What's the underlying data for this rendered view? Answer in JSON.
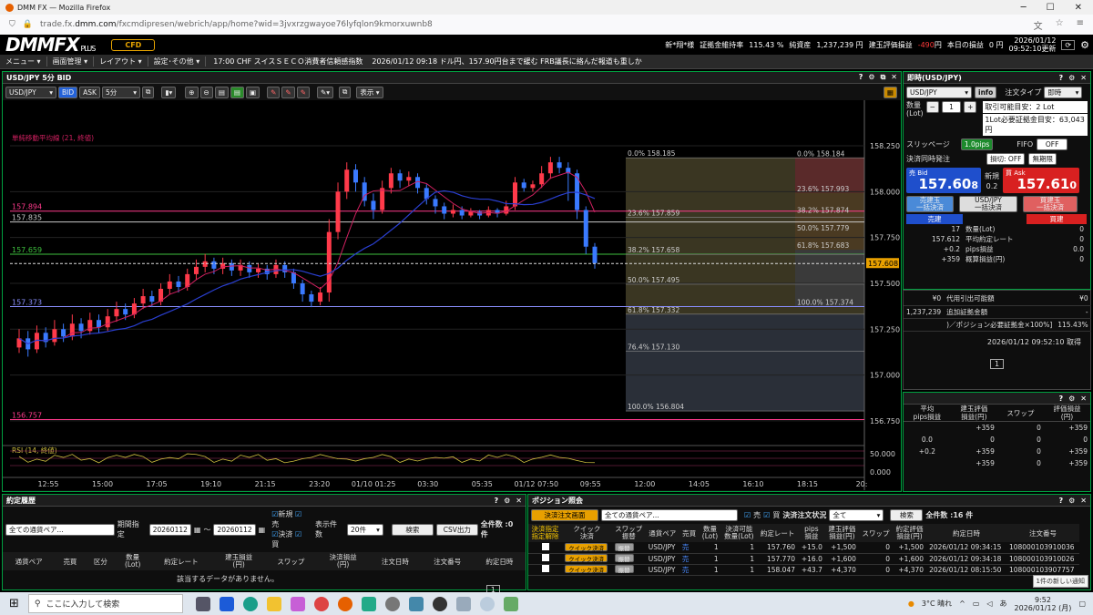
{
  "browser": {
    "window_title": "DMM FX — Mozilla Firefox",
    "url_prefix": "trade.fx.",
    "url_host": "dmm.com",
    "url_rest": "/fxcmdipresen/webrich/app/home?wid=3jvxrzgwayoe76lyfqlon9kmorxuwnb8"
  },
  "header": {
    "logo_main": "DMMFX",
    "logo_sub": "PLUS",
    "cfd_label": "CFD",
    "account_name": "新*翔*様",
    "margin_ratio_label": "証拠金維持率",
    "margin_ratio_value": "115.43 %",
    "net_assets_label": "純資産",
    "net_assets_value": "1,237,239 円",
    "unrealized_label": "建玉評価損益",
    "unrealized_value": "-490",
    "unrealized_unit": "円",
    "today_loss_label": "本日の損益",
    "today_loss_value": "0 円",
    "datetime_date": "2026/01/12",
    "datetime_time": "09:52:10更新"
  },
  "menubar": {
    "items": [
      "メニュー ▾",
      "画面管理 ▾",
      "レイアウト ▾",
      "設定･その他 ▾"
    ],
    "news1": "17:00 CHF スイスＳＥＣＯ消費者信頼感指数",
    "news2": "2026/01/12 09:18 ドル円、157.90円台まで緩む FRB議長に絡んだ報道も重しか"
  },
  "chart_panel": {
    "title": "USD/JPY 5分 BID",
    "pair": "USD/JPY",
    "bid": "BID",
    "ask": "ASK",
    "interval": "5分",
    "display_btn": "表示 ▾",
    "ma_label": "単純移動平均線 (21, 終値)",
    "rsi_label": "RSI (14, 終値)"
  },
  "chart_data": {
    "type": "candlestick",
    "ylim": [
      156.65,
      158.3
    ],
    "y_ticks": [
      "158.250",
      "158.000",
      "157.750",
      "157.500",
      "157.250",
      "157.000",
      "156.750"
    ],
    "x_ticks": [
      "12:55",
      "15:00",
      "17:05",
      "19:10",
      "21:15",
      "23:20",
      "01/10 01:25",
      "03:30",
      "05:35",
      "01/12 07:50",
      "09:55",
      "12:00",
      "14:05",
      "16:10",
      "18:15",
      "20:"
    ],
    "hlines": [
      {
        "label": "157.894",
        "value": 157.894,
        "color": "#ff3a8c"
      },
      {
        "label": "157.835",
        "value": 157.835,
        "color": "#c8c8c8"
      },
      {
        "label": "157.659",
        "value": 157.659,
        "color": "#3ec03e"
      },
      {
        "label": "157.373",
        "value": 157.373,
        "color": "#8a8fff"
      },
      {
        "label": "156.757",
        "value": 156.757,
        "color": "#ff3a8c"
      }
    ],
    "current_price": "157.608",
    "fib_left": [
      {
        "label": "0.0% 158.185",
        "value": 158.185
      },
      {
        "label": "23.6% 157.859",
        "value": 157.859
      },
      {
        "label": "38.2% 157.658",
        "value": 157.658
      },
      {
        "label": "50.0% 157.495",
        "value": 157.495
      },
      {
        "label": "61.8% 157.332",
        "value": 157.332
      },
      {
        "label": "76.4% 157.130",
        "value": 157.13
      },
      {
        "label": "100.0% 156.804",
        "value": 156.804
      }
    ],
    "fib_right": [
      {
        "label": "0.0% 158.184",
        "value": 158.184
      },
      {
        "label": "23.6% 157.993",
        "value": 157.993
      },
      {
        "label": "38.2% 157.874",
        "value": 157.874
      },
      {
        "label": "50.0% 157.779",
        "value": 157.779
      },
      {
        "label": "61.8% 157.683",
        "value": 157.683
      },
      {
        "label": "100.0% 157.374",
        "value": 157.374
      }
    ],
    "rsi_ticks": [
      "50.000",
      "0.000"
    ],
    "candles": [
      {
        "o": 157.15,
        "c": 157.2,
        "h": 157.25,
        "l": 157.12
      },
      {
        "o": 157.2,
        "c": 157.14,
        "h": 157.24,
        "l": 157.1
      },
      {
        "o": 157.14,
        "c": 157.23,
        "h": 157.27,
        "l": 157.12
      },
      {
        "o": 157.23,
        "c": 157.18,
        "h": 157.26,
        "l": 157.15
      },
      {
        "o": 157.18,
        "c": 157.25,
        "h": 157.3,
        "l": 157.16
      },
      {
        "o": 157.25,
        "c": 157.21,
        "h": 157.28,
        "l": 157.18
      },
      {
        "o": 157.21,
        "c": 157.28,
        "h": 157.33,
        "l": 157.19
      },
      {
        "o": 157.28,
        "c": 157.24,
        "h": 157.31,
        "l": 157.2
      },
      {
        "o": 157.24,
        "c": 157.3,
        "h": 157.34,
        "l": 157.22
      },
      {
        "o": 157.3,
        "c": 157.26,
        "h": 157.33,
        "l": 157.23
      },
      {
        "o": 157.26,
        "c": 157.32,
        "h": 157.36,
        "l": 157.24
      },
      {
        "o": 157.32,
        "c": 157.36,
        "h": 157.4,
        "l": 157.29
      },
      {
        "o": 157.36,
        "c": 157.33,
        "h": 157.39,
        "l": 157.3
      },
      {
        "o": 157.33,
        "c": 157.39,
        "h": 157.42,
        "l": 157.31
      },
      {
        "o": 157.39,
        "c": 157.43,
        "h": 157.47,
        "l": 157.36
      },
      {
        "o": 157.43,
        "c": 157.4,
        "h": 157.46,
        "l": 157.37
      },
      {
        "o": 157.4,
        "c": 157.47,
        "h": 157.5,
        "l": 157.38
      },
      {
        "o": 157.47,
        "c": 157.51,
        "h": 157.55,
        "l": 157.44
      },
      {
        "o": 157.51,
        "c": 157.48,
        "h": 157.54,
        "l": 157.45
      },
      {
        "o": 157.48,
        "c": 157.55,
        "h": 157.58,
        "l": 157.46
      },
      {
        "o": 157.55,
        "c": 157.59,
        "h": 157.63,
        "l": 157.52
      },
      {
        "o": 157.59,
        "c": 157.62,
        "h": 157.66,
        "l": 157.56
      },
      {
        "o": 157.62,
        "c": 157.58,
        "h": 157.64,
        "l": 157.55
      },
      {
        "o": 157.58,
        "c": 157.61,
        "h": 157.64,
        "l": 157.55
      },
      {
        "o": 157.61,
        "c": 157.57,
        "h": 157.63,
        "l": 157.54
      },
      {
        "o": 157.57,
        "c": 157.6,
        "h": 157.63,
        "l": 157.54
      },
      {
        "o": 157.6,
        "c": 157.56,
        "h": 157.62,
        "l": 157.53
      },
      {
        "o": 157.56,
        "c": 157.58,
        "h": 157.61,
        "l": 157.53
      },
      {
        "o": 157.58,
        "c": 157.55,
        "h": 157.6,
        "l": 157.52
      },
      {
        "o": 157.55,
        "c": 157.6,
        "h": 157.63,
        "l": 157.53
      },
      {
        "o": 157.6,
        "c": 157.56,
        "h": 157.62,
        "l": 157.53
      },
      {
        "o": 157.56,
        "c": 157.5,
        "h": 157.58,
        "l": 157.47
      },
      {
        "o": 157.5,
        "c": 157.44,
        "h": 157.52,
        "l": 157.4
      },
      {
        "o": 157.44,
        "c": 157.4,
        "h": 157.46,
        "l": 157.37
      },
      {
        "o": 157.4,
        "c": 157.45,
        "h": 157.48,
        "l": 157.38
      },
      {
        "o": 157.45,
        "c": 157.78,
        "h": 157.85,
        "l": 157.4
      },
      {
        "o": 157.78,
        "c": 158.0,
        "h": 158.05,
        "l": 157.74
      },
      {
        "o": 158.0,
        "c": 158.12,
        "h": 158.16,
        "l": 157.96
      },
      {
        "o": 158.12,
        "c": 158.05,
        "h": 158.15,
        "l": 158.0
      },
      {
        "o": 158.05,
        "c": 157.95,
        "h": 158.08,
        "l": 157.92
      },
      {
        "o": 157.95,
        "c": 157.9,
        "h": 157.99,
        "l": 157.85
      },
      {
        "o": 157.9,
        "c": 158.02,
        "h": 158.06,
        "l": 157.88
      },
      {
        "o": 158.02,
        "c": 158.1,
        "h": 158.13,
        "l": 157.99
      },
      {
        "o": 158.1,
        "c": 158.06,
        "h": 158.12,
        "l": 158.02
      },
      {
        "o": 158.06,
        "c": 158.08,
        "h": 158.11,
        "l": 158.03
      },
      {
        "o": 158.08,
        "c": 158.02,
        "h": 158.1,
        "l": 157.99
      },
      {
        "o": 158.02,
        "c": 157.96,
        "h": 158.04,
        "l": 157.93
      },
      {
        "o": 157.96,
        "c": 157.92,
        "h": 157.98,
        "l": 157.88
      },
      {
        "o": 157.92,
        "c": 157.88,
        "h": 157.94,
        "l": 157.85
      },
      {
        "o": 157.88,
        "c": 157.9,
        "h": 157.93,
        "l": 157.86
      },
      {
        "o": 157.9,
        "c": 157.87,
        "h": 157.92,
        "l": 157.85
      },
      {
        "o": 157.87,
        "c": 157.89,
        "h": 157.91,
        "l": 157.86
      },
      {
        "o": 157.89,
        "c": 157.87,
        "h": 157.9,
        "l": 157.85
      },
      {
        "o": 157.87,
        "c": 157.9,
        "h": 157.92,
        "l": 157.86
      },
      {
        "o": 157.9,
        "c": 157.88,
        "h": 157.91,
        "l": 157.86
      },
      {
        "o": 157.88,
        "c": 157.92,
        "h": 157.95,
        "l": 157.87
      },
      {
        "o": 157.92,
        "c": 158.05,
        "h": 158.08,
        "l": 157.9
      },
      {
        "o": 158.05,
        "c": 158.02,
        "h": 158.07,
        "l": 158.0
      },
      {
        "o": 158.02,
        "c": 158.04,
        "h": 158.06,
        "l": 158.0
      },
      {
        "o": 158.04,
        "c": 158.1,
        "h": 158.14,
        "l": 158.02
      },
      {
        "o": 158.1,
        "c": 158.16,
        "h": 158.19,
        "l": 158.07
      },
      {
        "o": 158.16,
        "c": 158.13,
        "h": 158.19,
        "l": 158.1
      },
      {
        "o": 158.13,
        "c": 158.1,
        "h": 158.16,
        "l": 157.95
      },
      {
        "o": 158.1,
        "c": 157.9,
        "h": 158.12,
        "l": 157.85
      },
      {
        "o": 157.9,
        "c": 157.7,
        "h": 157.92,
        "l": 157.66
      },
      {
        "o": 157.7,
        "c": 157.61,
        "h": 157.72,
        "l": 157.58
      }
    ]
  },
  "order_panel": {
    "title": "即時(USD/JPY)",
    "pair": "USD/JPY",
    "info": "info",
    "order_type_label": "注文タイプ",
    "order_type": "即時",
    "qty_label": "数量\n(Lot)",
    "qty_value": "1",
    "tradable_label": "取引可能目安：2 Lot",
    "margin_per_lot": "1Lot必要証拠金目安：63,043円",
    "slippage_label": "スリッページ",
    "slippage_value": "1.0pips",
    "fifo_label": "FIFO",
    "fifo_value": "OFF",
    "settle_label": "決済同時発注",
    "loss_cut": "損切: OFF",
    "unlimited": "無期限",
    "bid_label": "売 Bid",
    "bid_main": "157.60",
    "bid_pip": "8",
    "new_label": "新規",
    "spread": "0.2",
    "ask_label": "買 Ask",
    "ask_main": "157.61",
    "ask_pip": "0",
    "sell_bulk": "売建玉\n一括決済",
    "pair_bulk": "USD/JPY\n一括決済",
    "buy_bulk": "買建玉\n一括決済",
    "sell_head": "売建",
    "buy_head": "買建",
    "rows": [
      {
        "left": "17",
        "label": "数量(Lot)",
        "right": "0"
      },
      {
        "left": "157.612",
        "label": "平均約定レート",
        "right": "0"
      },
      {
        "left": "+0.2",
        "label": "pips損益",
        "right": "0.0"
      },
      {
        "left": "+359",
        "label": "概算損益(円)",
        "right": "0"
      }
    ]
  },
  "account_panel": {
    "rows": [
      {
        "left": "¥0",
        "label": "代用引出可能額",
        "right": "¥0"
      },
      {
        "left": "1,237,239",
        "label": "追加証拠金額",
        "right": "-"
      },
      {
        "left": "",
        "label": ")／ポジション必要証拠金×100%]",
        "right": "115.43%"
      }
    ],
    "updated": "2026/01/12 09:52:10 取得",
    "page": "1"
  },
  "summary_panel": {
    "headers": [
      "平均\npips損益",
      "建玉評価\n損益(円)",
      "スワップ",
      "評価損益\n(円)"
    ],
    "rows": [
      [
        "",
        "+359",
        "0",
        "+359"
      ],
      [
        "0.0",
        "0",
        "0",
        "0"
      ],
      [
        "+0.2",
        "+359",
        "0",
        "+359"
      ],
      [
        "",
        "+359",
        "0",
        "+359"
      ]
    ]
  },
  "fills_panel": {
    "title": "約定履歴",
    "pair_select": "全ての通貨ペア...",
    "period_label": "期間指定",
    "date_from": "20260112",
    "date_to": "20260112",
    "tilde": "～",
    "new_label": "新規",
    "close_label": "決済",
    "sell_label": "売",
    "buy_label": "買",
    "count_label": "表示件数",
    "count_value": "20件",
    "search": "検索",
    "csv": "CSV出力",
    "total": "全件数 :0 件",
    "headers": [
      "通貨ペア",
      "売買",
      "区分",
      "数量\n(Lot)",
      "約定レート",
      "建玉損益\n(円)",
      "スワップ",
      "決済損益\n(円)",
      "注文日時",
      "注文番号",
      "約定日時"
    ],
    "empty": "該当するデータがありません。",
    "page": "1"
  },
  "positions_panel": {
    "title": "ポジション照会",
    "specify_btn": "決済注文画面",
    "pair_select": "全ての通貨ペア...",
    "sell_label": "売",
    "buy_label": "買",
    "status_label": "決済注文状況",
    "status_value": "全て",
    "search": "検索",
    "total": "全件数 :16 件",
    "headers": [
      "決済指定\n指定解除",
      "クイック\n決済",
      "スワップ\n振替",
      "通貨ペア",
      "売買",
      "数量\n(Lot)",
      "決済可能\n数量(Lot)",
      "約定レート",
      "pips\n損益",
      "建玉評価\n損益(円)",
      "スワップ",
      "約定評価\n損益(円)",
      "約定日時",
      "注文番号"
    ],
    "quick_label": "クイック決済",
    "swap_label": "振替",
    "rows": [
      {
        "pair": "USD/JPY",
        "side": "売",
        "qty": "1",
        "avail": "1",
        "rate": "157.760",
        "pips": "+15.0",
        "pl": "+1,500",
        "swap": "0",
        "total": "+1,500",
        "date": "2026/01/12 09:34:15",
        "no": "108000103910036"
      },
      {
        "pair": "USD/JPY",
        "side": "売",
        "qty": "1",
        "avail": "1",
        "rate": "157.770",
        "pips": "+16.0",
        "pl": "+1,600",
        "swap": "0",
        "total": "+1,600",
        "date": "2026/01/12 09:34:18",
        "no": "108000103910026"
      },
      {
        "pair": "USD/JPY",
        "side": "売",
        "qty": "1",
        "avail": "1",
        "rate": "158.047",
        "pips": "+43.7",
        "pl": "+4,370",
        "swap": "0",
        "total": "+4,370",
        "date": "2026/01/12 08:15:50",
        "no": "108000103907757"
      }
    ],
    "tooltip": "1件の新しい通知"
  },
  "taskbar": {
    "search_placeholder": "ここに入力して検索",
    "weather": "3°C 晴れ",
    "time": "9:52",
    "date": "2026/01/12 (月)"
  }
}
